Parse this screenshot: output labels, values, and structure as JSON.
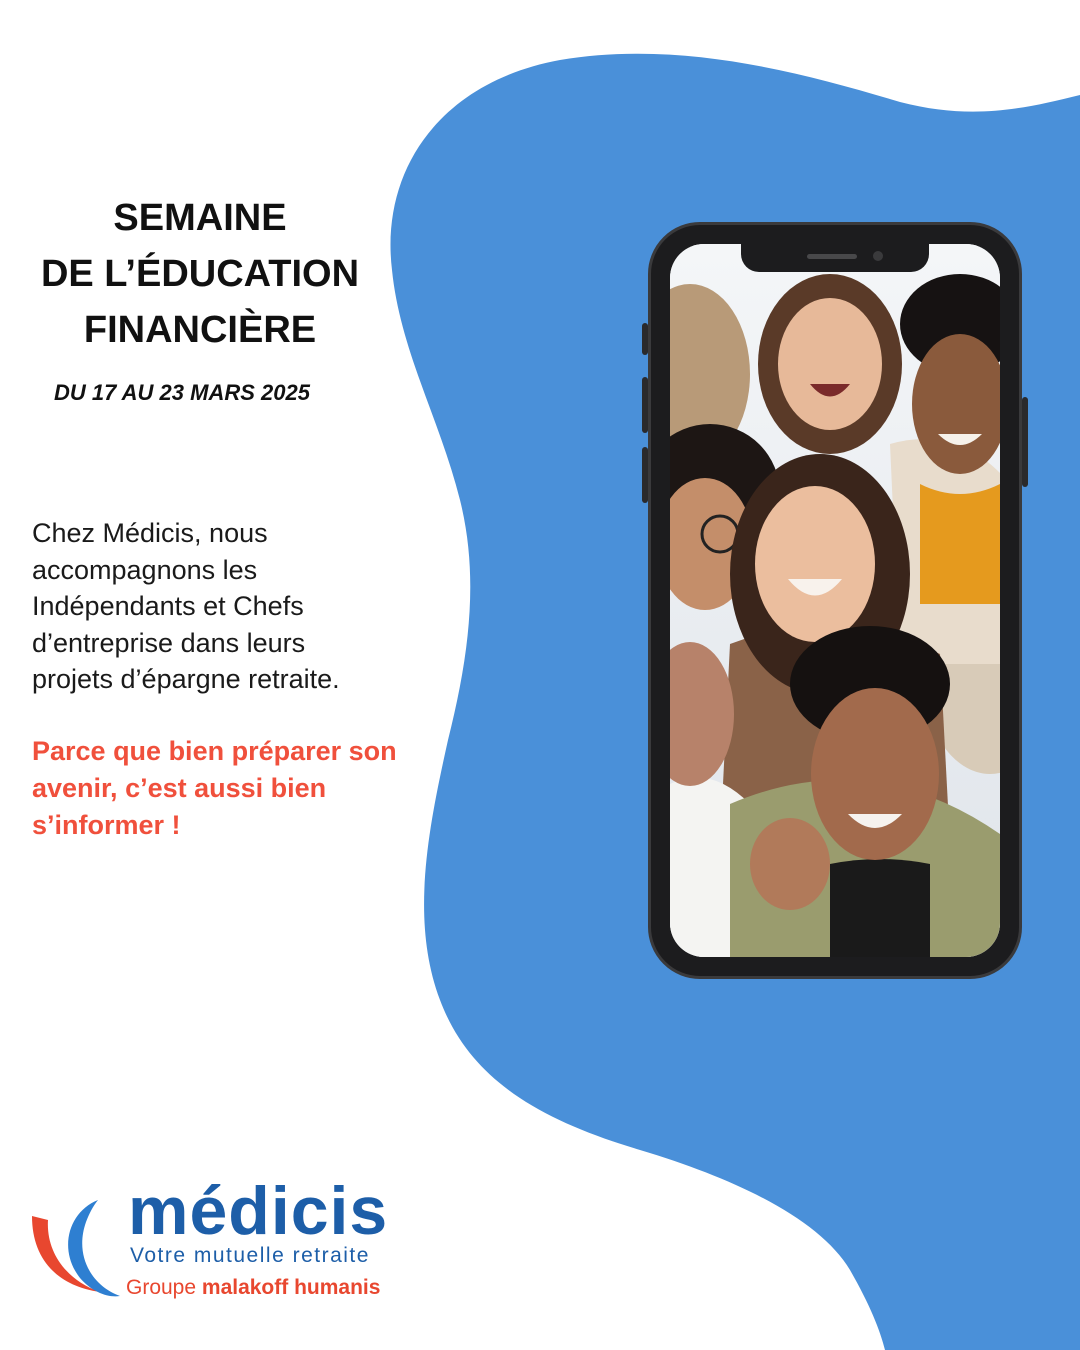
{
  "title": {
    "lines": [
      "SEMAINE",
      "DE L’ÉDUCATION",
      "FINANCIÈRE"
    ]
  },
  "dates": "DU 17 AU 23 MARS 2025",
  "body": {
    "lines": [
      "Chez Médicis, nous",
      "accompagnons les",
      "Indépendants et Chefs",
      "d’entreprise dans leurs",
      "projets d’épargne retraite."
    ]
  },
  "highlight": {
    "lines": [
      "Parce que bien préparer son",
      "avenir, c’est aussi bien",
      "s’informer !"
    ]
  },
  "logo": {
    "name": "médicis",
    "tagline": "Votre mutuelle retraite",
    "group_prefix": "Groupe",
    "group_name": "malakoff humanis"
  },
  "colors": {
    "blob_blue": "#4a90d9",
    "brand_blue": "#1d5ea8",
    "accent_red": "#f0503c"
  },
  "icons": {
    "phone": "smartphone-mockup",
    "logo_mark": "medicis-crescent-logo"
  }
}
